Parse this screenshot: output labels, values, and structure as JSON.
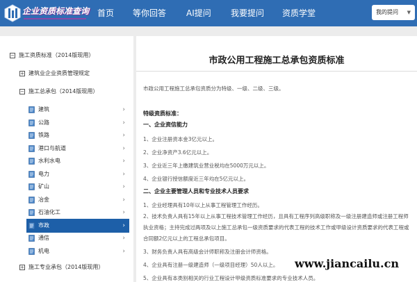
{
  "header": {
    "logo_text": "企业资质标准查询",
    "nav": [
      "首页",
      "等你回答",
      "AI提问",
      "我要提问",
      "资质学堂"
    ],
    "search_dropdown": "我的提问"
  },
  "sidebar": {
    "root": "施工资质标准（2014版现用）",
    "node_rule": "建筑业企业资质管理规定",
    "node_general": "施工总承包（2014版现用）",
    "items": [
      "建筑",
      "公路",
      "铁路",
      "港口与航道",
      "水利水电",
      "电力",
      "矿山",
      "冶金",
      "石油化工",
      "市政",
      "通信",
      "机电"
    ],
    "active_item": "市政",
    "node_specialty": "施工专业承包（2014版现用）"
  },
  "content": {
    "title": "市政公用工程施工总承包资质标准",
    "intro": "市政公用工程施工总承包资质分为特级、一级、二级、三级。",
    "special_heading": "特级资质标准：",
    "sec1_heading": "一、企业资信能力",
    "sec1_items": [
      "1、企业注册资本金3亿元以上。",
      "2、企业净资产3.6亿元以上。",
      "3、企业近三年上缴建筑业营业税均在5000万元以上。",
      "4、企业银行授信额度近三年均在5亿元以上。"
    ],
    "sec2_heading": "二、企业主要管理人员和专业技术人员要求",
    "sec2_items": [
      "1、企业经理具有10年以上从事工程管理工作经历。",
      "2、技术负责人具有15年以上从事工程技术管理工作经历，且具有工程序列高级职称及一级注册建造师或注册工程师执业资格；主持完成过两项及以上施工总承包一级资质要求的代表工程的技术工作或甲级设计资质要求的代表工程或合同额2亿元以上的工程总承包项目。",
      "3、财务负责人具有高级会计师职称及注册会计师资格。",
      "4、企业具有注册一级建造师（一级项目经理）50人以上。",
      "5、企业具有本类别相关的行业工程设计甲级资质标准要求的专业技术人员。"
    ]
  },
  "watermark": "www.jiancailu.cn",
  "colors": {
    "nav_bg": "#2f6db4",
    "active_item": "#1d5fa8",
    "page_bg": "#ececec"
  }
}
